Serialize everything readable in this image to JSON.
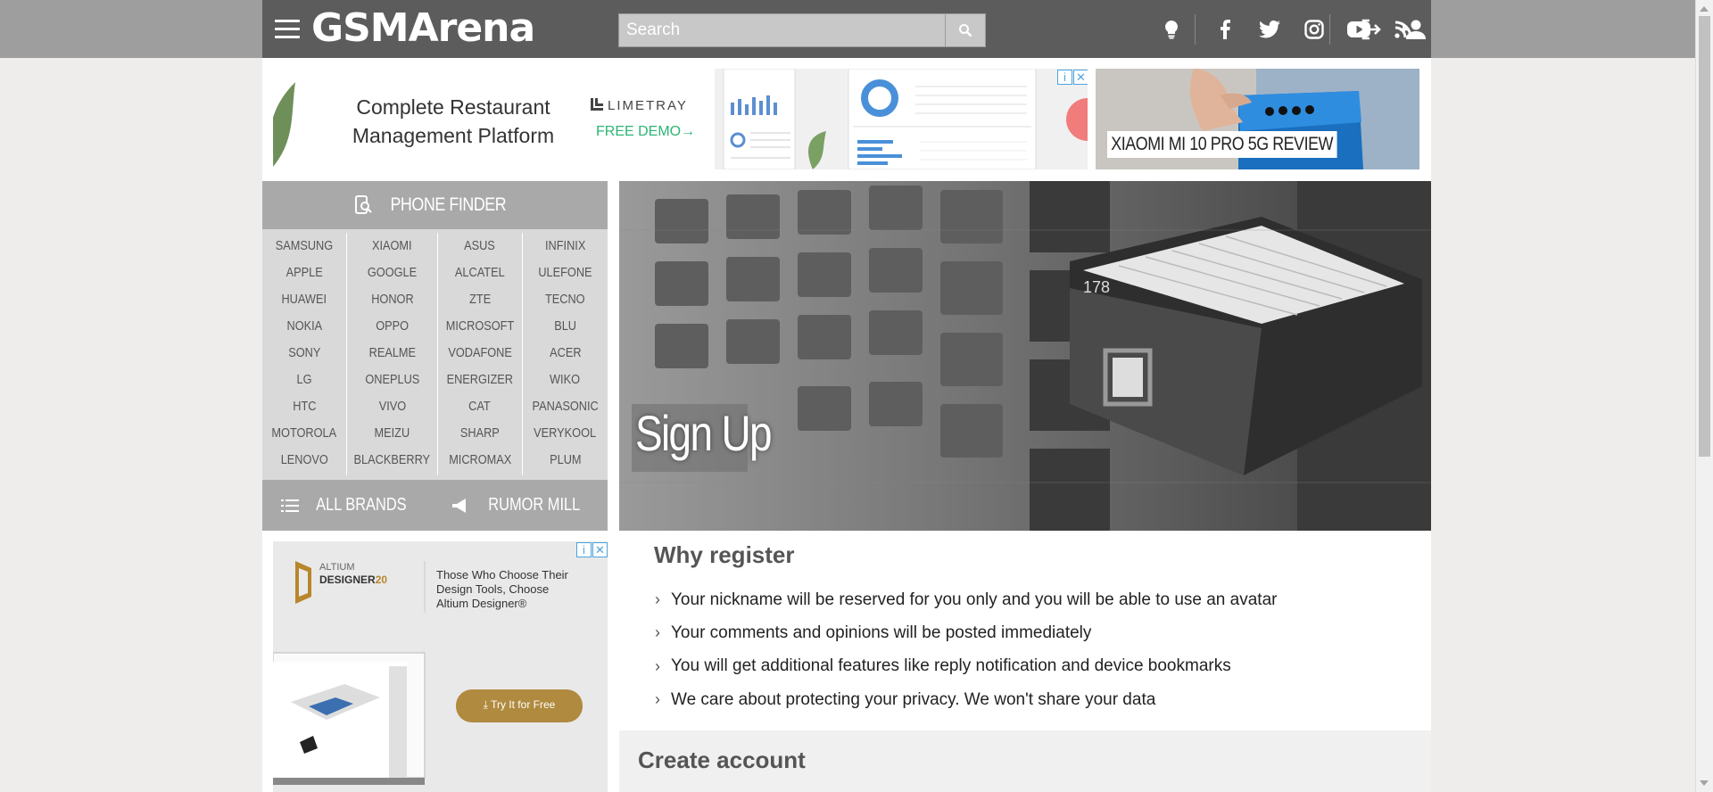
{
  "header": {
    "logo": "GSMArena",
    "search_placeholder": "Search",
    "icons": [
      "menu-icon",
      "search-icon",
      "lightbulb-icon",
      "facebook-icon",
      "twitter-icon",
      "instagram-icon",
      "youtube-icon",
      "rss-icon",
      "login-icon",
      "add-user-icon"
    ]
  },
  "ad_top": {
    "headline": "Complete Restaurant Management Platform",
    "brand": "LIMETRAY",
    "cta": "FREE DEMO→"
  },
  "promo": {
    "label": "XIAOMI MI 10 PRO 5G REVIEW"
  },
  "phone_finder": {
    "title": "PHONE FINDER",
    "columns": [
      [
        "SAMSUNG",
        "APPLE",
        "HUAWEI",
        "NOKIA",
        "SONY",
        "LG",
        "HTC",
        "MOTOROLA",
        "LENOVO"
      ],
      [
        "XIAOMI",
        "GOOGLE",
        "HONOR",
        "OPPO",
        "REALME",
        "ONEPLUS",
        "VIVO",
        "MEIZU",
        "BLACKBERRY"
      ],
      [
        "ASUS",
        "ALCATEL",
        "ZTE",
        "MICROSOFT",
        "VODAFONE",
        "ENERGIZER",
        "CAT",
        "SHARP",
        "MICROMAX"
      ],
      [
        "INFINIX",
        "ULEFONE",
        "TECNO",
        "BLU",
        "ACER",
        "WIKO",
        "PANASONIC",
        "VERYKOOL",
        "PLUM"
      ]
    ],
    "all_brands": "ALL BRANDS",
    "rumor_mill": "RUMOR MILL"
  },
  "ad_side": {
    "brand": "ALTIUM DESIGNER 20",
    "headline": "Those Who Choose Their Design Tools, Choose Altium Designer®",
    "cta": "Try It for Free"
  },
  "hero": {
    "title": "Sign Up"
  },
  "why": {
    "title": "Why register",
    "items": [
      "Your nickname will be reserved for you only and you will be able to use an avatar",
      "Your comments and opinions will be posted immediately",
      "You will get additional features like reply notification and device bookmarks",
      "We care about protecting your privacy. We won't share your data"
    ]
  },
  "create": {
    "title": "Create account"
  }
}
